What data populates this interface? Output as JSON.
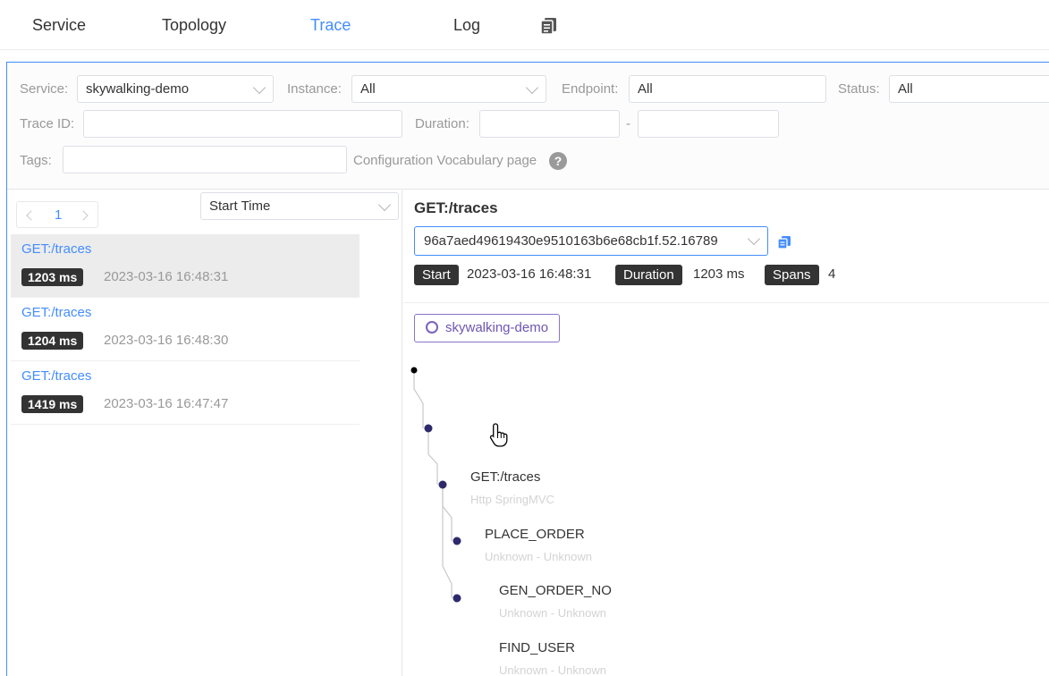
{
  "nav": {
    "tabs": [
      {
        "label": "Service"
      },
      {
        "label": "Topology"
      },
      {
        "label": "Trace",
        "active": true
      },
      {
        "label": "Log"
      }
    ],
    "doc_icon": "document-copy-icon"
  },
  "filters": {
    "service_label": "Service:",
    "service_value": "skywalking-demo",
    "instance_label": "Instance:",
    "instance_value": "All",
    "endpoint_label": "Endpoint:",
    "endpoint_value": "All",
    "status_label": "Status:",
    "status_value": "All",
    "trace_id_label": "Trace ID:",
    "trace_id_value": "",
    "duration_label": "Duration:",
    "duration_min": "",
    "duration_sep": "-",
    "duration_max": "",
    "tags_label": "Tags:",
    "tags_value": "",
    "vocab_link": "Configuration Vocabulary page",
    "help_icon": "question-circle-icon"
  },
  "list": {
    "page": "1",
    "sort_value": "Start Time",
    "traces": [
      {
        "endpoint": "GET:/traces",
        "duration": "1203 ms",
        "time": "2023-03-16 16:48:31",
        "selected": true
      },
      {
        "endpoint": "GET:/traces",
        "duration": "1204 ms",
        "time": "2023-03-16 16:48:30",
        "selected": false
      },
      {
        "endpoint": "GET:/traces",
        "duration": "1419 ms",
        "time": "2023-03-16 16:47:47",
        "selected": false
      }
    ]
  },
  "detail": {
    "title": "GET:/traces",
    "trace_id": "96a7aed49619430e9510163b6e68cb1f.52.16789",
    "start_label": "Start",
    "start_value": "2023-03-16 16:48:31",
    "duration_label": "Duration",
    "duration_value": "1203 ms",
    "spans_label": "Spans",
    "spans_value": "4",
    "service_legend": "skywalking-demo",
    "colors": {
      "accent": "#448dfe",
      "node": "#2d2a6b",
      "legend": "#6f56b3"
    },
    "spans": [
      {
        "name": "GET:/traces",
        "sub": "Http SpringMVC"
      },
      {
        "name": "PLACE_ORDER",
        "sub": "Unknown - Unknown"
      },
      {
        "name": "GEN_ORDER_NO",
        "sub": "Unknown - Unknown"
      },
      {
        "name": "FIND_USER",
        "sub": "Unknown - Unknown"
      }
    ]
  }
}
